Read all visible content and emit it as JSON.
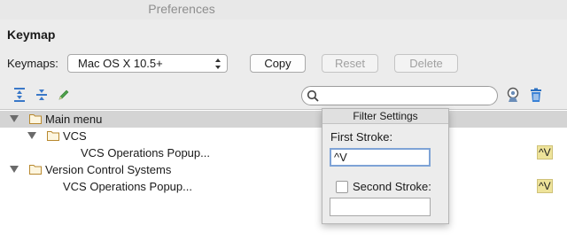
{
  "window": {
    "title": "Preferences"
  },
  "section": {
    "title": "Keymap"
  },
  "keymaps": {
    "label": "Keymaps:",
    "selected": "Mac OS X 10.5+"
  },
  "buttons": {
    "copy": "Copy",
    "reset": "Reset",
    "delete": "Delete"
  },
  "search": {
    "value": ""
  },
  "tree": {
    "rows": [
      {
        "label": "Main menu",
        "shortcut": ""
      },
      {
        "label": "VCS",
        "shortcut": ""
      },
      {
        "label": "VCS Operations Popup...",
        "shortcut": "^V"
      },
      {
        "label": "Version Control Systems",
        "shortcut": ""
      },
      {
        "label": "VCS Operations Popup...",
        "shortcut": "^V"
      }
    ]
  },
  "filter_popup": {
    "title": "Filter Settings",
    "first_stroke_label": "First Stroke:",
    "first_stroke_value": "^V",
    "second_stroke_label": "Second Stroke:",
    "second_stroke_checked": false,
    "second_stroke_value": ""
  },
  "colors": {
    "selection": "#d4d4d4",
    "shortcut_bg": "#eee39a",
    "folder": "#c9a24a"
  }
}
